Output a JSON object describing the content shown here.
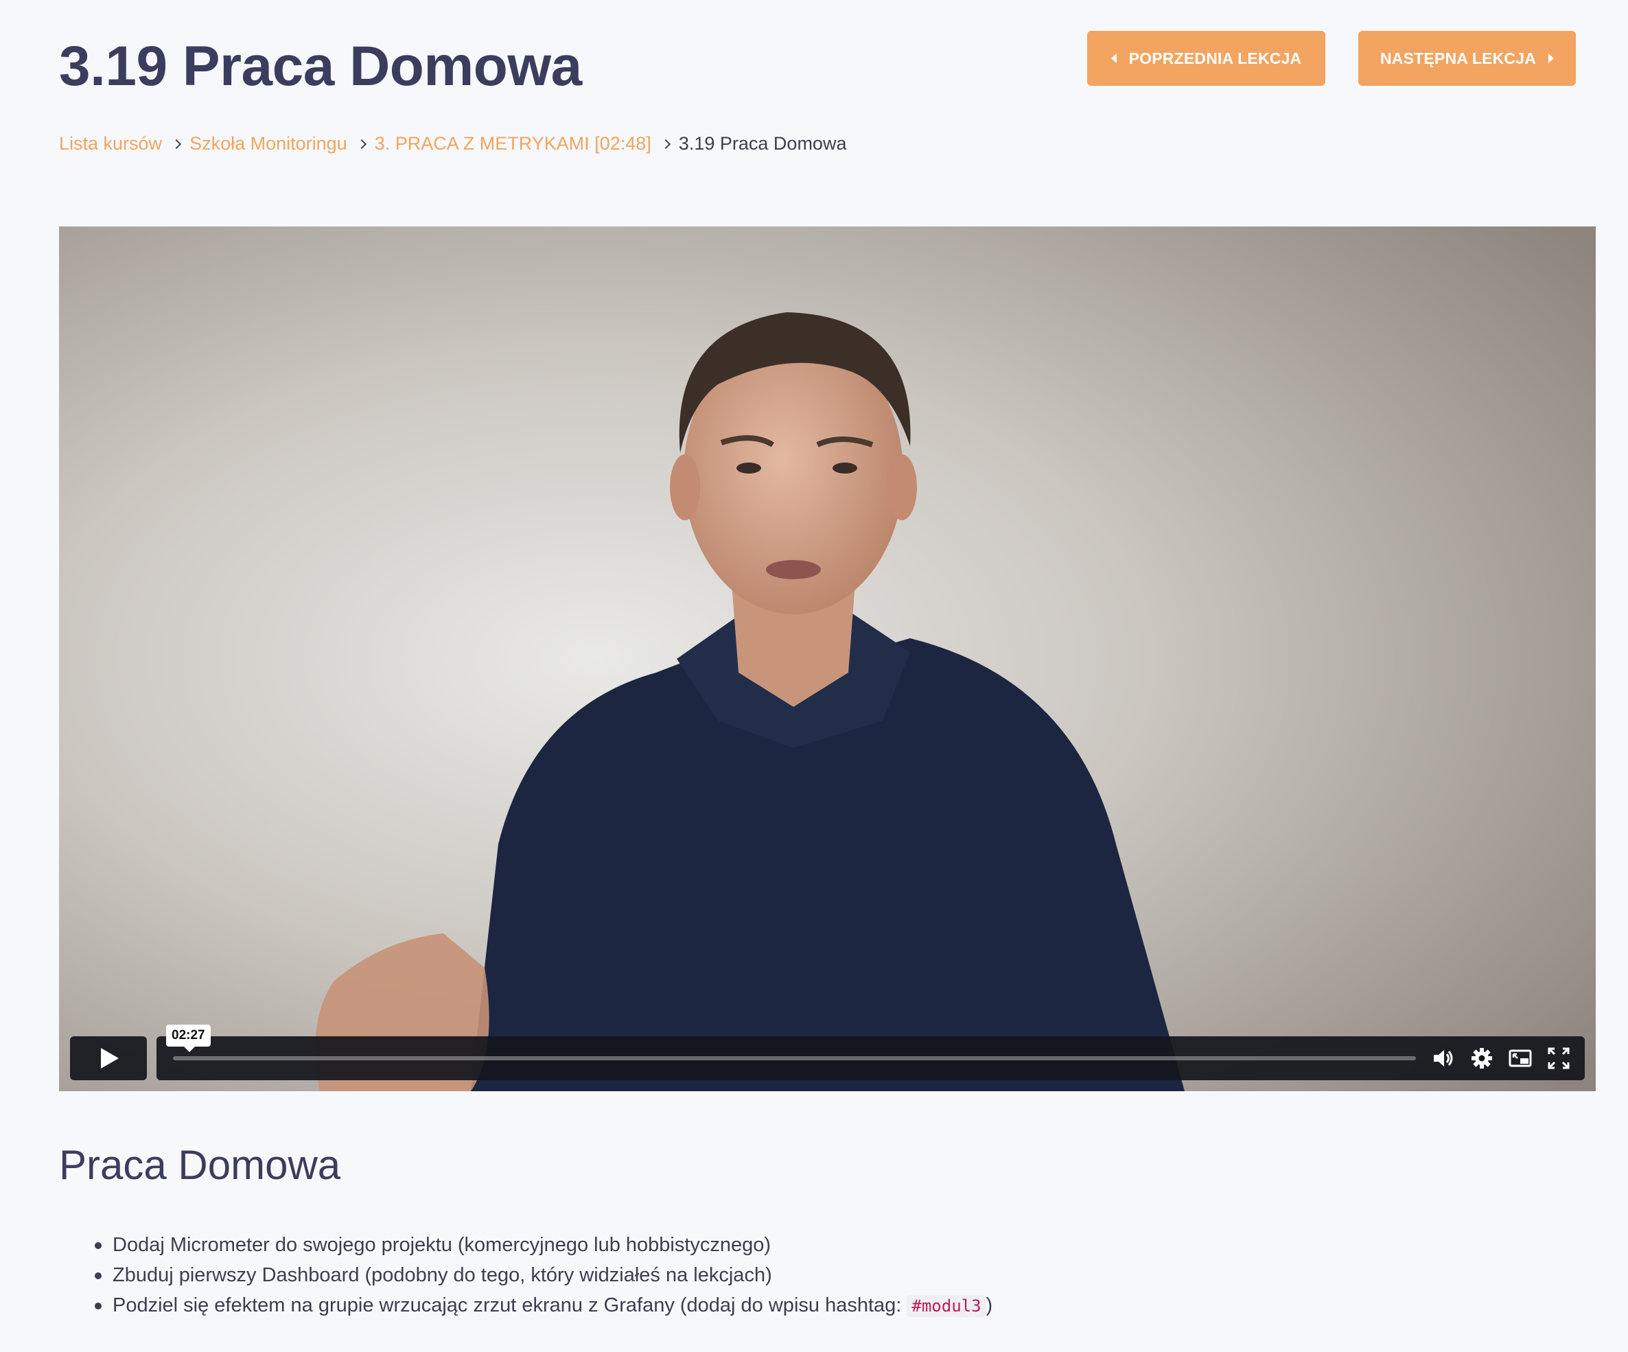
{
  "header": {
    "title": "3.19 Praca Domowa",
    "prev_button": "POPRZEDNIA LEKCJA",
    "next_button": "NASTĘPNA LEKCJA"
  },
  "breadcrumb": {
    "items": [
      "Lista kursów",
      "Szkoła Monitoringu",
      "3. PRACA Z METRYKAMI [02:48]"
    ],
    "current": "3.19 Praca Domowa"
  },
  "video": {
    "time_tooltip": "02:27",
    "progress": 0,
    "controls": [
      "play-icon",
      "volume-icon",
      "gear-icon",
      "picture-in-picture-icon",
      "fullscreen-icon"
    ]
  },
  "content": {
    "heading": "Praca Domowa",
    "tasks": [
      "Dodaj Micrometer do swojego projektu (komercyjnego lub hobbistycznego)",
      "Zbuduj pierwszy Dashboard (podobny do tego, który widziałeś na lekcjach)"
    ],
    "task3_before": "Podziel się efektem na grupie wrzucając zrzut ekranu z Grafany (dodaj do wpisu hashtag: ",
    "task3_code": "#modul3",
    "task3_after": ")"
  },
  "colors": {
    "accent": "#f2a460",
    "title": "#3b3d5e",
    "background": "#f7f8fb",
    "code": "#c2185b"
  }
}
